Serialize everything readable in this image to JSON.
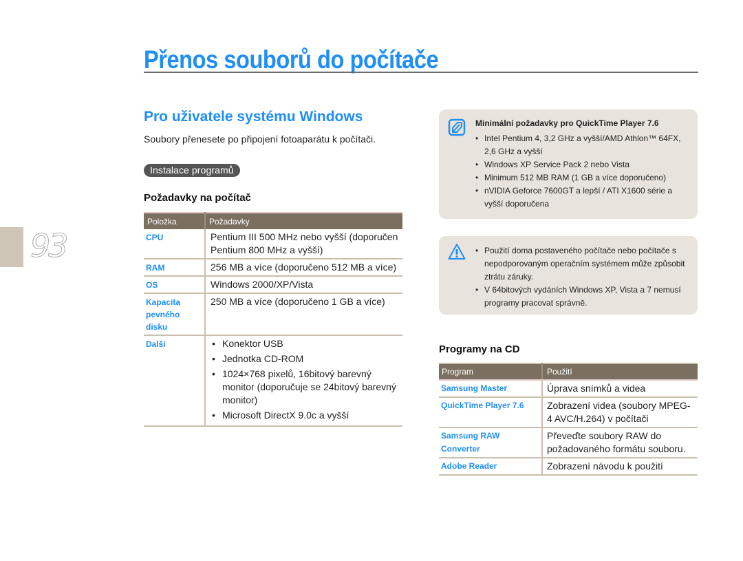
{
  "page": {
    "number": "93",
    "title": "Přenos souborů do počítače"
  },
  "left": {
    "section_title": "Pro uživatele systému Windows",
    "intro": "Soubory přenesete po připojení fotoaparátu k počítači.",
    "pill_label": "Instalace programů",
    "requirements_title": "Požadavky na počítač",
    "table": {
      "headers": [
        "Položka",
        "Požadavky"
      ],
      "rows": [
        {
          "key": "CPU",
          "value": "Pentium III 500 MHz nebo vyšší (doporučen Pentium 800 MHz a vyšší)"
        },
        {
          "key": "RAM",
          "value": "256 MB a více (doporučeno 512 MB a více)"
        },
        {
          "key": "OS",
          "value": "Windows 2000/XP/Vista"
        },
        {
          "key": "Kapacita pevného disku",
          "value": "250 MB a více (doporučeno 1 GB a více)"
        },
        {
          "key": "Další",
          "items": [
            "Konektor USB",
            "Jednotka CD-ROM",
            "1024×768 pixelů, 16bitový barevný monitor (doporučuje se 24bitový barevný monitor)",
            "Microsoft DirectX 9.0c a vyšší"
          ]
        }
      ]
    }
  },
  "note": {
    "icon": "note-pencil-icon",
    "title": "Minimální požadavky pro QuickTime Player 7.6",
    "items": [
      "Intel Pentium 4, 3,2 GHz a vyšší/AMD Athlon™ 64FX, 2,6 GHz a vyšší",
      "Windows XP Service Pack 2 nebo Vista",
      "Minimum 512 MB RAM (1 GB a více doporučeno)",
      "nVIDIA Geforce 7600GT a lepší / ATI X1600 série a vyšší doporučena"
    ]
  },
  "warning": {
    "icon": "warning-triangle-icon",
    "items": [
      "Použití doma postaveného počítače nebo počítače s nepodporovaným operačním systémem může způsobit ztrátu záruky.",
      "V 64bitových vydáních Windows XP, Vista a 7 nemusí programy pracovat správně."
    ]
  },
  "cd": {
    "title": "Programy na CD",
    "headers": [
      "Program",
      "Použití"
    ],
    "rows": [
      {
        "program": "Samsung Master",
        "use": "Úprava snímků a videa"
      },
      {
        "program": "QuickTime Player 7.6",
        "use": "Zobrazení videa (soubory MPEG-4 AVC/H.264) v počítači"
      },
      {
        "program": "Samsung RAW Converter",
        "use": "Převeďte soubory RAW do požadovaného formátu souboru."
      },
      {
        "program": "Adobe Reader",
        "use": "Zobrazení návodu k použití"
      }
    ]
  },
  "colors": {
    "accent": "#1f8ef5",
    "table_header": "#7b7060",
    "note_bg": "#e8e4dd",
    "page_tab": "#cfc6b7"
  }
}
